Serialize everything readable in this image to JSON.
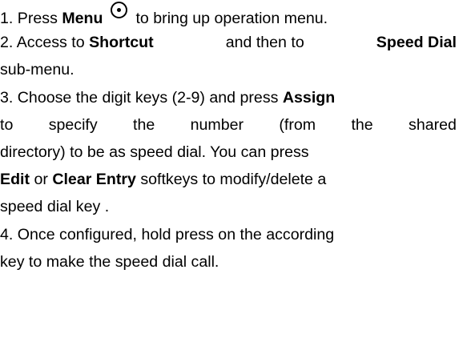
{
  "step1": {
    "prefix": "1. Press ",
    "bold": "Menu",
    "suffix": "to bring up operation menu.",
    "icon": "menu-button-icon"
  },
  "step2": {
    "prefix": "2. Access to ",
    "bold1": "Shortcut",
    "middle": "and then to",
    "bold2": "Speed Dial",
    "cont": "sub-menu."
  },
  "step3": {
    "prefix": "3. Choose the digit keys (2-9) and press ",
    "bold_assign": "Assign",
    "line2_words": [
      "to",
      "specify",
      "the",
      "number",
      "(from",
      "the",
      "shared"
    ],
    "line3": "directory) to be as speed dial. You can press",
    "bold_edit": "Edit",
    "or": " or ",
    "bold_clear": "Clear Entry",
    "line4_suffix": " softkeys to modify/delete a",
    "line5": "speed dial key ."
  },
  "step4": {
    "line1": "4. Once configured, hold press on the according",
    "line2": "key to make the speed dial call."
  }
}
